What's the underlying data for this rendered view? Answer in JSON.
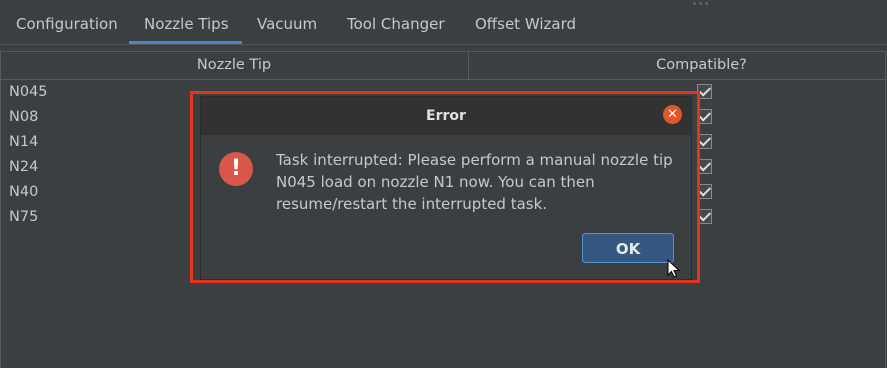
{
  "tabs": [
    {
      "label": "Configuration"
    },
    {
      "label": "Nozzle Tips"
    },
    {
      "label": "Vacuum"
    },
    {
      "label": "Tool Changer"
    },
    {
      "label": "Offset Wizard"
    }
  ],
  "active_tab": "Nozzle Tips",
  "table": {
    "columns": [
      "Nozzle Tip",
      "Compatible?"
    ],
    "rows": [
      {
        "tip": "N045",
        "compatible": true
      },
      {
        "tip": "N08",
        "compatible": true
      },
      {
        "tip": "N14",
        "compatible": true
      },
      {
        "tip": "N24",
        "compatible": true
      },
      {
        "tip": "N40",
        "compatible": true
      },
      {
        "tip": "N75",
        "compatible": true
      }
    ]
  },
  "dialog": {
    "title": "Error",
    "message_lines": [
      "Task interrupted: Please perform a manual nozzle tip",
      "N045 load on nozzle N1 now. You can then",
      "resume/restart the interrupted task."
    ],
    "ok_label": "OK",
    "icon": "error-icon",
    "close_icon": "close-icon"
  },
  "colors": {
    "accent": "#4a88c7",
    "highlight_border": "#e3341e",
    "error_icon": "#d9574a"
  }
}
